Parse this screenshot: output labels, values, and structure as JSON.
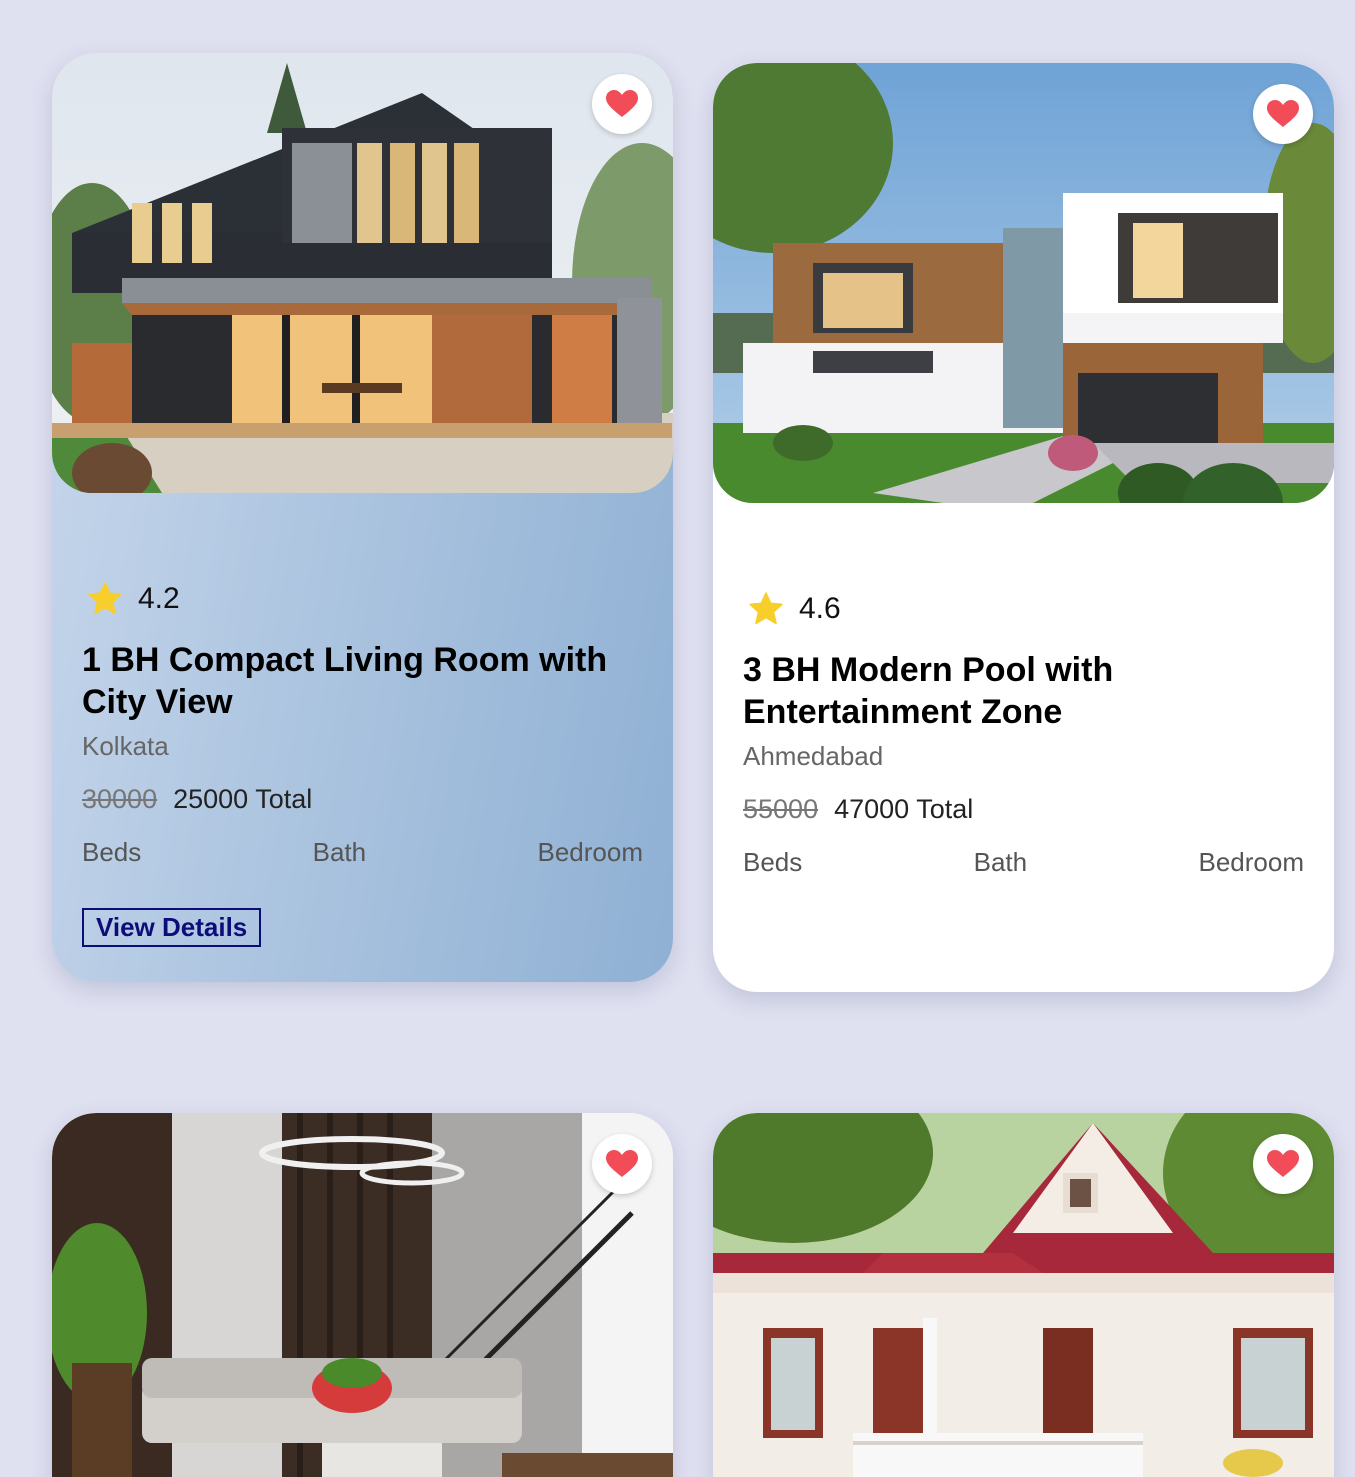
{
  "colors": {
    "page_background": "#dfe0f0",
    "heart": "#f14c57",
    "star": "#f8cf2a",
    "view_button": "#0d0d7a"
  },
  "listings": [
    {
      "rating": "4.2",
      "title": "1 BH Compact Living Room with City View",
      "city": "Kolkata",
      "old_price": "30000",
      "price": "25000 Total",
      "specs": [
        "Beds",
        "Bath",
        "Bedroom"
      ],
      "view_label": "View Details",
      "favorite_icon": "heart-icon"
    },
    {
      "rating": "4.6",
      "title": "3 BH Modern Pool with Entertainment Zone",
      "city": "Ahmedabad",
      "old_price": "55000",
      "price": "47000 Total",
      "specs": [
        "Beds",
        "Bath",
        "Bedroom"
      ],
      "favorite_icon": "heart-icon"
    },
    {
      "favorite_icon": "heart-icon"
    },
    {
      "favorite_icon": "heart-icon"
    }
  ]
}
